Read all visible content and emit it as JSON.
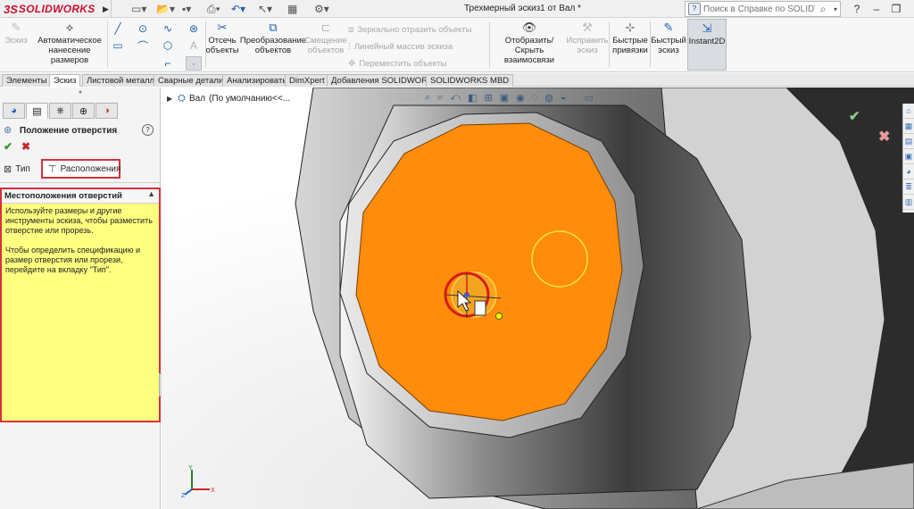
{
  "app": {
    "logo_prefix": "3S",
    "logo_text": "SOLIDWORKS",
    "document_title": "Трехмерный эскиз1 от Вал *",
    "search_placeholder": "Поиск в Справке по SOLIDWORKS",
    "window_controls": [
      "?",
      "–",
      "❐"
    ]
  },
  "quick_access_icons": [
    "new-icon",
    "open-icon",
    "save-icon",
    "print-icon",
    "undo-icon",
    "select-icon",
    "rebuild-icon",
    "options-icon"
  ],
  "commands": {
    "sketch": "Эскиз",
    "smart_dimension": "Автоматическое нанесение размеров",
    "trim": "Отсечь объекты",
    "convert": "Преобразование объектов",
    "offset": "Смещение объектов",
    "mirror": "Зеркально отразить объекты",
    "linear_pattern": "Линейный массив эскиза",
    "move": "Переместить объекты",
    "display_relations": "Отобразить/Скрыть взаимосвязи",
    "repair": "Исправить эскиз",
    "quick_snaps": "Быстрые привязки",
    "rapid_sketch": "Быстрый эскиз",
    "instant2d": "Instant2D"
  },
  "tabs": [
    {
      "label": "Элементы",
      "active": false
    },
    {
      "label": "Эскиз",
      "active": true
    },
    {
      "label": "Листовой металл",
      "active": false
    },
    {
      "label": "Сварные детали",
      "active": false
    },
    {
      "label": "Анализировать",
      "active": false
    },
    {
      "label": "DimXpert",
      "active": false
    },
    {
      "label": "Добавления SOLIDWORKS",
      "active": false
    },
    {
      "label": "SOLIDWORKS MBD",
      "active": false
    }
  ],
  "property_manager": {
    "title": "Положение отверстия",
    "subtabs": {
      "type": "Тип",
      "positions": "Расположения"
    },
    "section_title": "Местоположения отверстий",
    "help_paragraph_1": "Используйте размеры и другие инструменты эскиза, чтобы разместить отверстие или прорезь.",
    "help_paragraph_2": "Чтобы определить спецификацию и размер отверстия или прорези, перейдите на вкладку \"Тип\"."
  },
  "tree": {
    "part_name": "Вал",
    "config": "(По умолчанию<<..."
  },
  "colors": {
    "highlight_red": "#d9303c",
    "face_orange": "#ff8c0a",
    "hint_yellow": "#ffff80",
    "accent_blue": "#1f5fb0"
  }
}
